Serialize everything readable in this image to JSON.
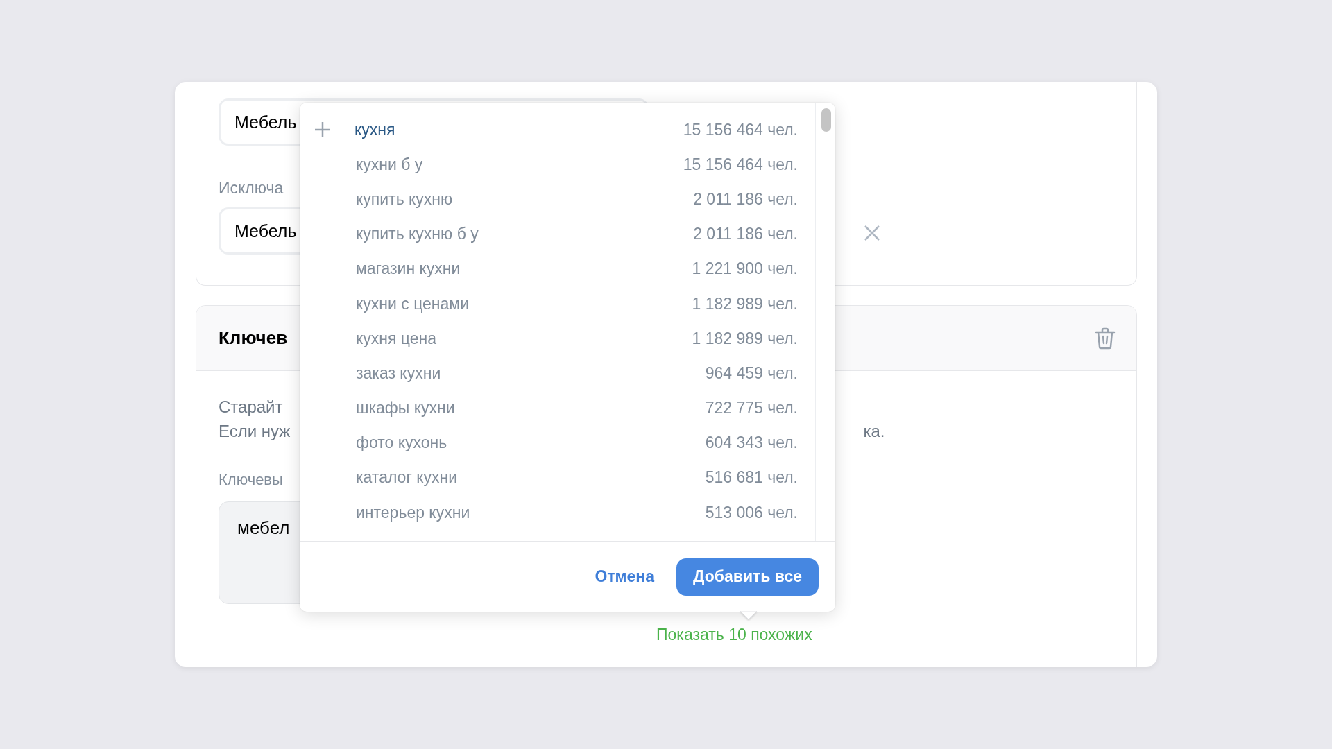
{
  "filters": {
    "field_1": {
      "value": "Мебель"
    },
    "exclude_label": "Исключа",
    "field_2": {
      "value": "Мебель"
    }
  },
  "keywords_section": {
    "title": "Ключев",
    "hint_lines": [
      "Старайт",
      "Если нуж"
    ],
    "hint_tail": "ка.",
    "field_label": "Ключевы",
    "field": {
      "value": "мебел"
    },
    "similar_link": "Показать 10 похожих"
  },
  "suggestions": {
    "items": [
      {
        "text": "кухня",
        "count": "15 156 464 чел.",
        "selected": true
      },
      {
        "text": "кухни б у",
        "count": "15 156 464 чел.",
        "selected": false
      },
      {
        "text": "купить кухню",
        "count": "2 011 186 чел.",
        "selected": false
      },
      {
        "text": "купить кухню б у",
        "count": "2 011 186 чел.",
        "selected": false
      },
      {
        "text": "магазин кухни",
        "count": "1 221 900 чел.",
        "selected": false
      },
      {
        "text": "кухни с ценами",
        "count": "1 182 989 чел.",
        "selected": false
      },
      {
        "text": "кухня цена",
        "count": "1 182 989 чел.",
        "selected": false
      },
      {
        "text": "заказ кухни",
        "count": "964 459 чел.",
        "selected": false
      },
      {
        "text": "шкафы кухни",
        "count": "722 775 чел.",
        "selected": false
      },
      {
        "text": "фото кухонь",
        "count": "604 343 чел.",
        "selected": false
      },
      {
        "text": "каталог кухни",
        "count": "516 681 чел.",
        "selected": false
      },
      {
        "text": "интерьер кухни",
        "count": "513 006 чел.",
        "selected": false
      }
    ],
    "buttons": [
      {
        "label": "Отмена",
        "kind": "link"
      },
      {
        "label": "Добавить все",
        "kind": "primary"
      }
    ]
  }
}
